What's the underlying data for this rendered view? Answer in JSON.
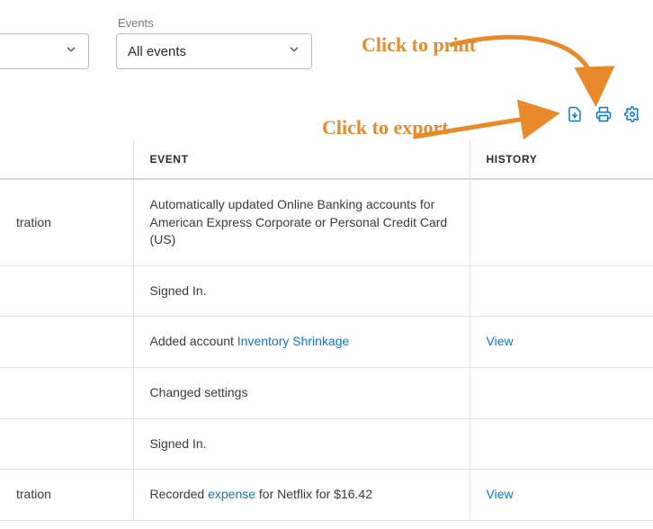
{
  "filters": {
    "events_label": "Events",
    "events_value": "All events"
  },
  "columns": {
    "event": "EVENT",
    "history": "HISTORY"
  },
  "rows": [
    {
      "left": "tration",
      "event_pre": "Automatically updated Online Banking accounts for American Express Corporate or Personal Credit Card (US)",
      "link": "",
      "event_post": "",
      "history": ""
    },
    {
      "left": "",
      "event_pre": "Signed In.",
      "link": "",
      "event_post": "",
      "history": ""
    },
    {
      "left": "",
      "event_pre": "Added account ",
      "link": "Inventory Shrinkage",
      "event_post": "",
      "history": "View"
    },
    {
      "left": "",
      "event_pre": "Changed settings",
      "link": "",
      "event_post": "",
      "history": ""
    },
    {
      "left": "",
      "event_pre": "Signed In.",
      "link": "",
      "event_post": "",
      "history": ""
    },
    {
      "left": "tration",
      "event_pre": "Recorded ",
      "link": "expense",
      "event_post": " for Netflix for $16.42",
      "history": "View"
    }
  ],
  "annotations": {
    "print": "Click to print",
    "export": "Click to export"
  }
}
